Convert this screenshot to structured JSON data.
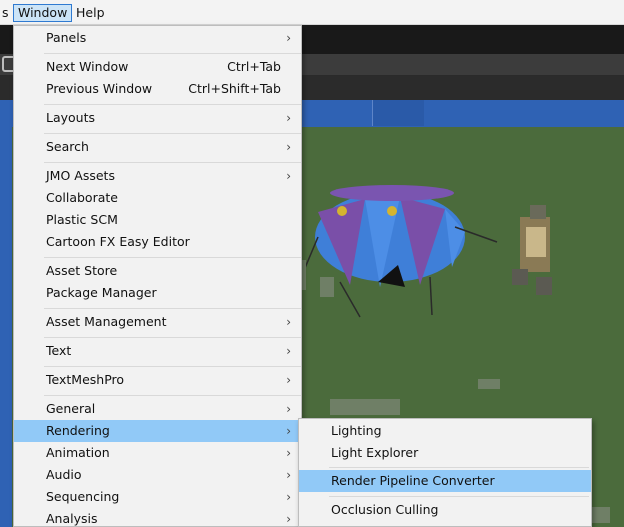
{
  "menubar": {
    "items": [
      {
        "label": "s"
      },
      {
        "label": "Window"
      },
      {
        "label": "Help"
      }
    ],
    "active_index": 1
  },
  "window_menu": {
    "items": [
      {
        "label": "Panels",
        "shortcut": "",
        "submenu": true
      },
      {
        "label": "Next Window",
        "shortcut": "Ctrl+Tab",
        "submenu": false
      },
      {
        "label": "Previous Window",
        "shortcut": "Ctrl+Shift+Tab",
        "submenu": false
      },
      {
        "label": "Layouts",
        "shortcut": "",
        "submenu": true
      },
      {
        "label": "Search",
        "shortcut": "",
        "submenu": true
      },
      {
        "label": "JMO Assets",
        "shortcut": "",
        "submenu": true
      },
      {
        "label": "Collaborate",
        "shortcut": "",
        "submenu": false
      },
      {
        "label": "Plastic SCM",
        "shortcut": "",
        "submenu": false
      },
      {
        "label": "Cartoon FX Easy Editor",
        "shortcut": "",
        "submenu": false
      },
      {
        "label": "Asset Store",
        "shortcut": "",
        "submenu": false
      },
      {
        "label": "Package Manager",
        "shortcut": "",
        "submenu": false
      },
      {
        "label": "Asset Management",
        "shortcut": "",
        "submenu": true
      },
      {
        "label": "Text",
        "shortcut": "",
        "submenu": true
      },
      {
        "label": "TextMeshPro",
        "shortcut": "",
        "submenu": true
      },
      {
        "label": "General",
        "shortcut": "",
        "submenu": true
      },
      {
        "label": "Rendering",
        "shortcut": "",
        "submenu": true
      },
      {
        "label": "Animation",
        "shortcut": "",
        "submenu": true
      },
      {
        "label": "Audio",
        "shortcut": "",
        "submenu": true
      },
      {
        "label": "Sequencing",
        "shortcut": "",
        "submenu": true
      },
      {
        "label": "Analysis",
        "shortcut": "",
        "submenu": true
      }
    ],
    "highlighted": "Rendering",
    "arrow_glyph": "›"
  },
  "rendering_submenu": {
    "items": [
      {
        "label": "Lighting"
      },
      {
        "label": "Light Explorer"
      },
      {
        "label": "Render Pipeline Converter"
      },
      {
        "label": "Occlusion Culling"
      }
    ],
    "highlighted": "Render Pipeline Converter"
  },
  "colors": {
    "menu_bg": "#f2f2f2",
    "highlight": "#91c9f7",
    "menubar_active": "#cce4f7",
    "scene_ground": "#4b6b3c",
    "scene_blue": "#2f62b4"
  }
}
